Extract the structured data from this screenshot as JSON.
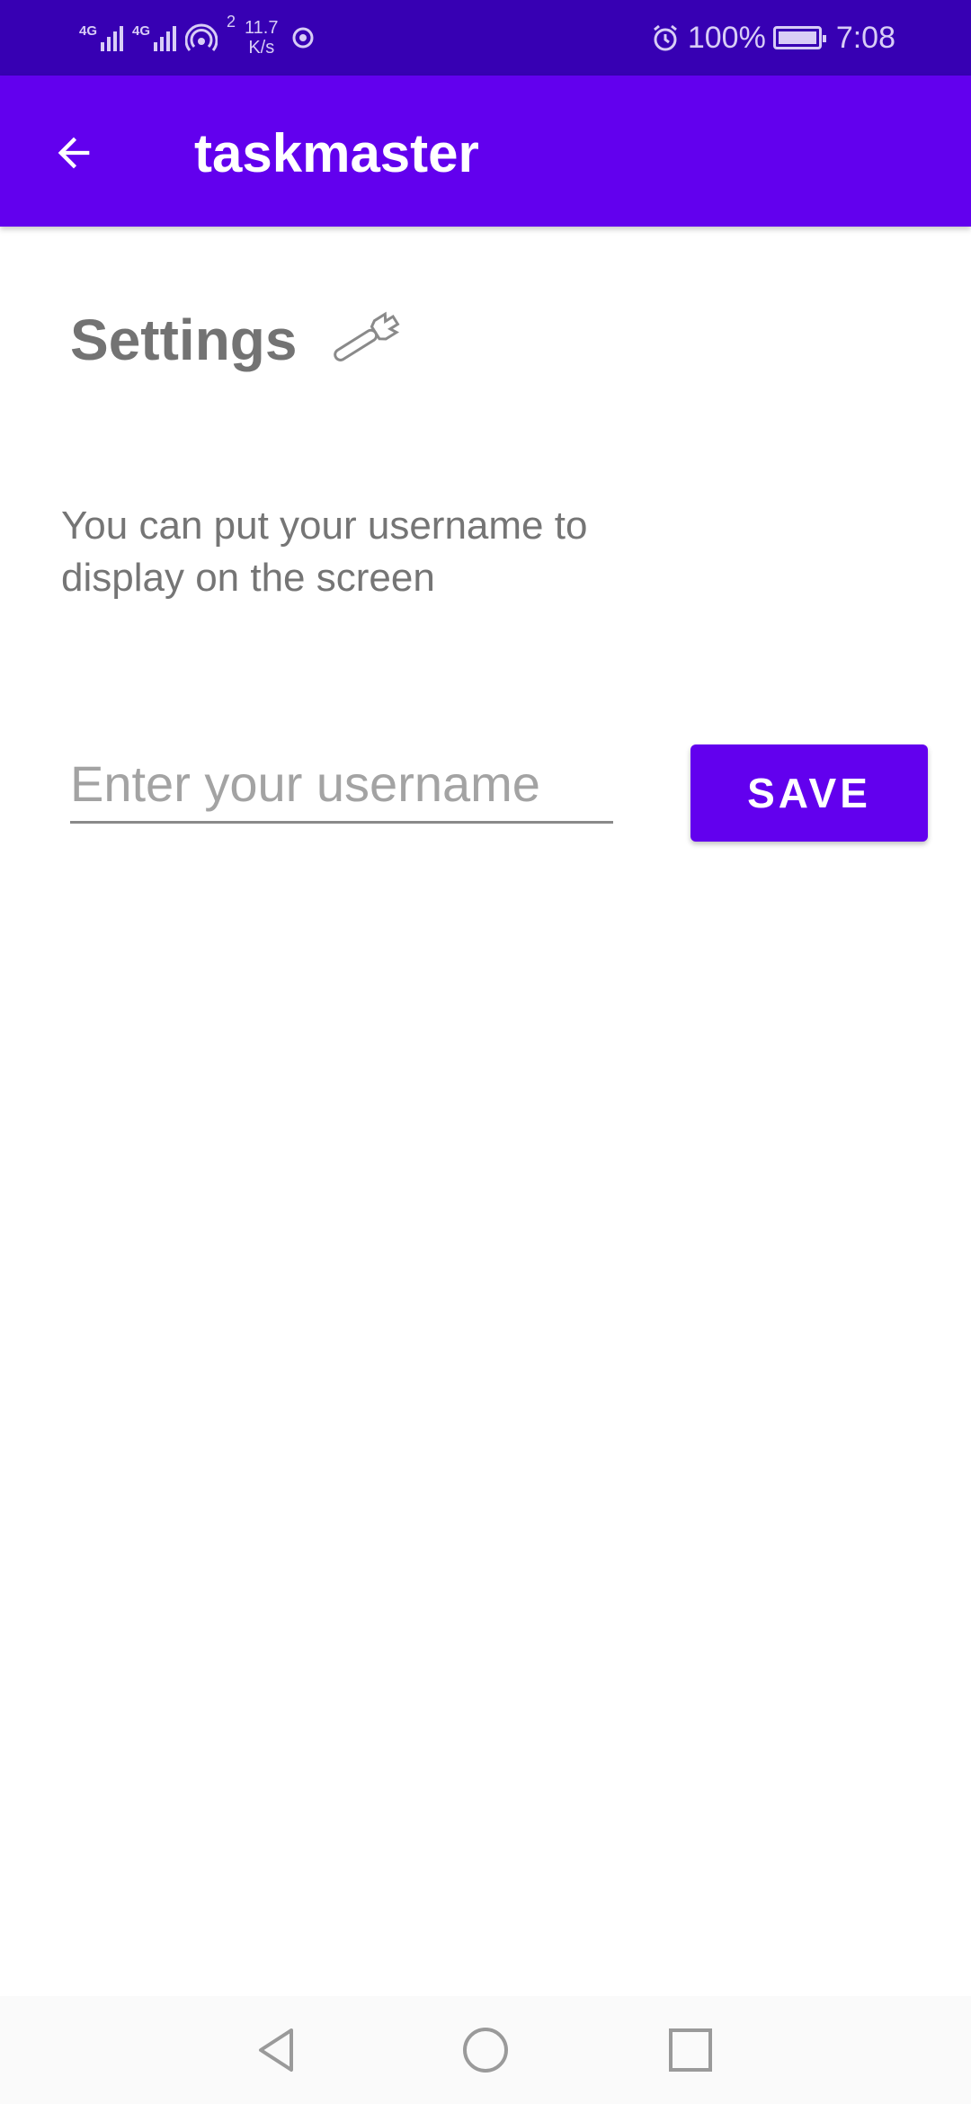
{
  "status_bar": {
    "network_1": "4G",
    "network_2": "4G",
    "hotspot_count": "2",
    "speed_value": "11.7",
    "speed_unit": "K/s",
    "battery": "100%",
    "time": "7:08"
  },
  "app_bar": {
    "title": "taskmaster",
    "back_icon": "arrow-back-icon"
  },
  "settings": {
    "title": "Settings",
    "icon": "wrench-icon",
    "description": "You can put your username to display on the screen"
  },
  "form": {
    "username_value": "",
    "username_placeholder": "Enter your username",
    "save_label": "SAVE"
  },
  "nav_bar": {
    "icons": [
      "back-triangle-icon",
      "home-circle-icon",
      "recents-square-icon"
    ]
  },
  "colors": {
    "primary": "#6200EE",
    "primary_dark": "#3700B3",
    "text_secondary": "#757575"
  }
}
